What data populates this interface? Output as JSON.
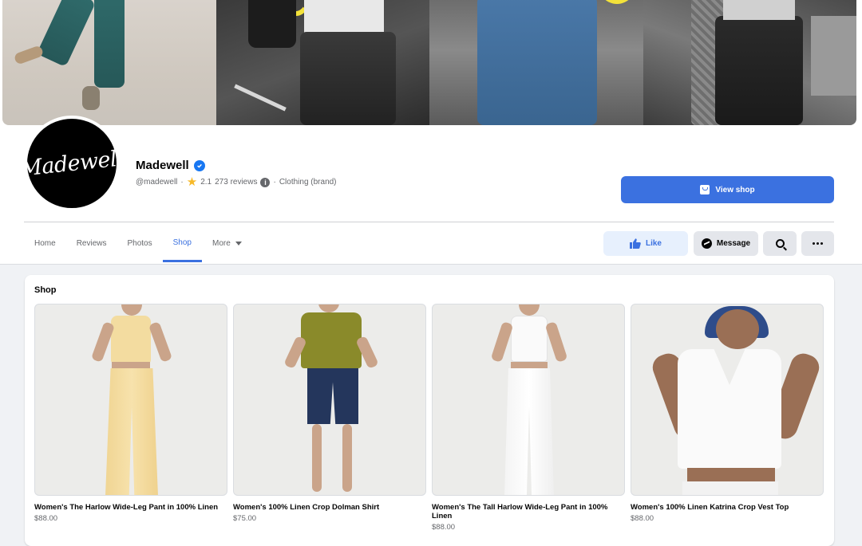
{
  "page": {
    "name": "Madewell",
    "avatar_text": "Madewell",
    "handle": "@madewell",
    "rating": "2.1",
    "reviews": "273 reviews",
    "category": "Clothing (brand)",
    "separator": "·"
  },
  "header_actions": {
    "view_shop": "View shop"
  },
  "tabs": [
    {
      "label": "Home"
    },
    {
      "label": "Reviews"
    },
    {
      "label": "Photos"
    },
    {
      "label": "Shop"
    },
    {
      "label": "More"
    }
  ],
  "actions": {
    "like": "Like",
    "message": "Message"
  },
  "shop": {
    "heading": "Shop",
    "products": [
      {
        "name": "Women's The Harlow Wide-Leg Pant in 100% Linen",
        "price": "$88.00"
      },
      {
        "name": "Women's 100% Linen Crop Dolman Shirt",
        "price": "$75.00"
      },
      {
        "name": "Women's The Tall Harlow Wide-Leg Pant in 100% Linen",
        "price": "$88.00"
      },
      {
        "name": "Women's 100% Linen Katrina Crop Vest Top",
        "price": "$88.00"
      }
    ]
  },
  "colors": {
    "accent": "#3b71e0",
    "verified": "#1877f2",
    "star": "#f7b928"
  }
}
